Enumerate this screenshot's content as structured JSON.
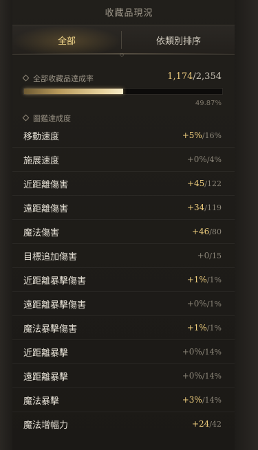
{
  "header": {
    "title": "收藏品現況"
  },
  "tabs": [
    {
      "label": "全部",
      "active": true
    },
    {
      "label": "依類別排序",
      "active": false
    }
  ],
  "completion": {
    "label": "全部收藏品達成率",
    "current": "1,174",
    "total": "2,354",
    "percent": "49.87%",
    "progress_fraction": 0.4987
  },
  "stats_section": {
    "label": "圖鑑達成度"
  },
  "stats": [
    {
      "name": "移動速度",
      "current": "+5%",
      "max": "16%",
      "highlight": true
    },
    {
      "name": "施展速度",
      "current": "+0%",
      "max": "4%",
      "highlight": false
    },
    {
      "name": "近距離傷害",
      "current": "+45",
      "max": "122",
      "highlight": true
    },
    {
      "name": "遠距離傷害",
      "current": "+34",
      "max": "119",
      "highlight": true
    },
    {
      "name": "魔法傷害",
      "current": "+46",
      "max": "80",
      "highlight": true
    },
    {
      "name": "目標追加傷害",
      "current": "+0",
      "max": "15",
      "highlight": false
    },
    {
      "name": "近距離暴擊傷害",
      "current": "+1%",
      "max": "1%",
      "highlight": true
    },
    {
      "name": "遠距離暴擊傷害",
      "current": "+0%",
      "max": "1%",
      "highlight": false
    },
    {
      "name": "魔法暴擊傷害",
      "current": "+1%",
      "max": "1%",
      "highlight": true
    },
    {
      "name": "近距離暴擊",
      "current": "+0%",
      "max": "14%",
      "highlight": false
    },
    {
      "name": "遠距離暴擊",
      "current": "+0%",
      "max": "14%",
      "highlight": false
    },
    {
      "name": "魔法暴擊",
      "current": "+3%",
      "max": "14%",
      "highlight": true
    },
    {
      "name": "魔法增幅力",
      "current": "+24",
      "max": "42",
      "highlight": true
    }
  ],
  "colors": {
    "highlight": "#f0cf7e",
    "dim": "#8a8477",
    "active_tab": "#f0d58a"
  }
}
